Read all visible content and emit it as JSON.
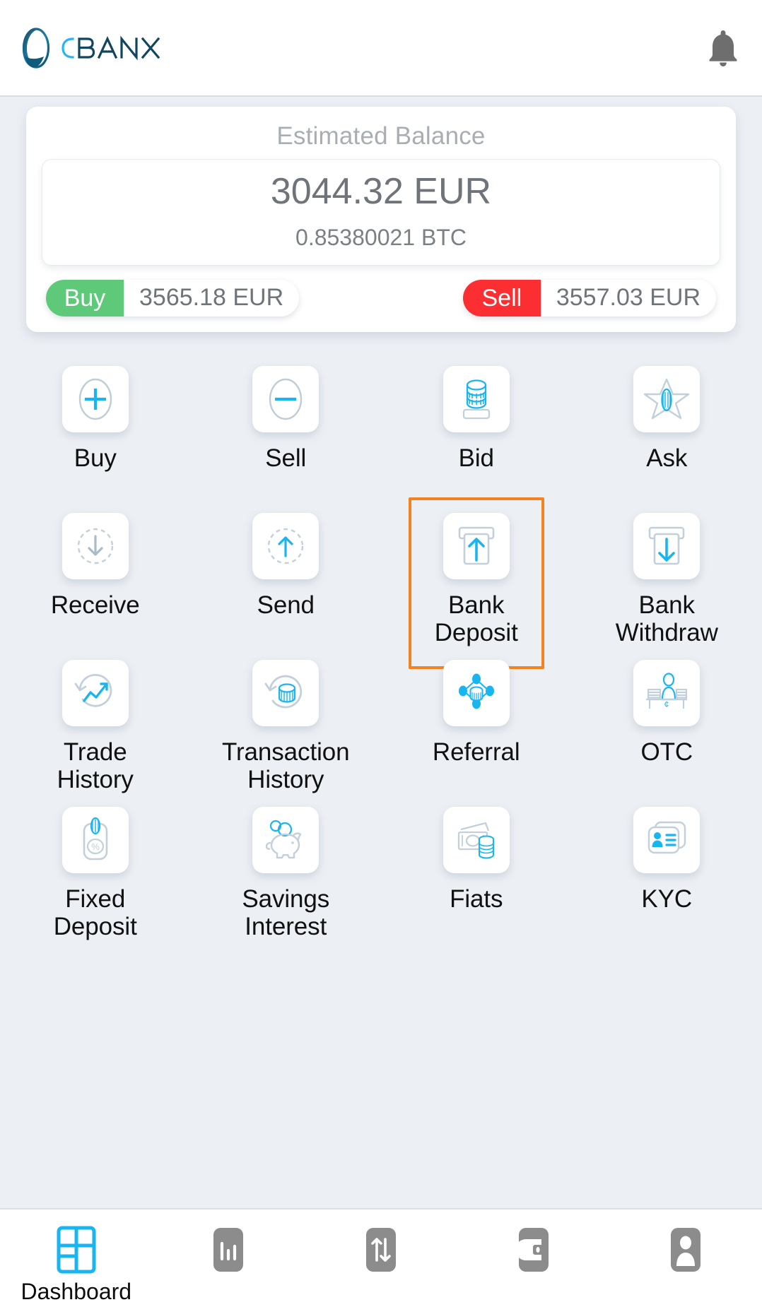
{
  "header": {
    "logo_text": "CBANX",
    "logo_icon": "cbanx-o-logo-icon",
    "notification_icon": "bell-icon"
  },
  "balance": {
    "title": "Estimated Balance",
    "primary": "3044.32 EUR",
    "secondary": "0.85380021 BTC",
    "buy": {
      "label": "Buy",
      "value": "3565.18 EUR",
      "color": "#5fc97a"
    },
    "sell": {
      "label": "Sell",
      "value": "3557.03 EUR",
      "color": "#fb2f32"
    }
  },
  "grid": {
    "highlight_color": "#f58220",
    "highlighted_item": "Bank Deposit",
    "rows": [
      [
        {
          "label": "Buy",
          "icon": "plus-circle-icon"
        },
        {
          "label": "Sell",
          "icon": "minus-circle-icon"
        },
        {
          "label": "Bid",
          "icon": "coin-stack-bid-icon"
        },
        {
          "label": "Ask",
          "icon": "star-coin-ask-icon"
        }
      ],
      [
        {
          "label": "Receive",
          "icon": "arrow-down-dashed-circle-icon"
        },
        {
          "label": "Send",
          "icon": "arrow-up-dashed-circle-icon"
        },
        {
          "label": "Bank\nDeposit",
          "icon": "bank-deposit-arrow-up-icon"
        },
        {
          "label": "Bank\nWithdraw",
          "icon": "bank-withdraw-arrow-down-icon"
        }
      ],
      [
        {
          "label": "Trade\nHistory",
          "icon": "trade-history-chart-icon"
        },
        {
          "label": "Transaction\nHistory",
          "icon": "transaction-history-coin-icon"
        },
        {
          "label": "Referral",
          "icon": "referral-network-icon"
        },
        {
          "label": "OTC",
          "icon": "otc-desk-icon"
        }
      ],
      [
        {
          "label": "Fixed\nDeposit",
          "icon": "fixed-deposit-percent-icon"
        },
        {
          "label": "Savings\nInterest",
          "icon": "piggy-bank-icon"
        },
        {
          "label": "Fiats",
          "icon": "fiat-banknote-coins-icon"
        },
        {
          "label": "KYC",
          "icon": "kyc-id-card-icon"
        }
      ]
    ]
  },
  "bottom_nav": {
    "active_index": 0,
    "active_color": "#18b5f0",
    "inactive_color": "#8c8c8c",
    "items": [
      {
        "label": "Dashboard",
        "icon": "dashboard-grid-icon"
      },
      {
        "label": "",
        "icon": "bar-chart-icon"
      },
      {
        "label": "",
        "icon": "exchange-arrows-icon"
      },
      {
        "label": "",
        "icon": "wallet-icon"
      },
      {
        "label": "",
        "icon": "profile-person-icon"
      }
    ]
  }
}
